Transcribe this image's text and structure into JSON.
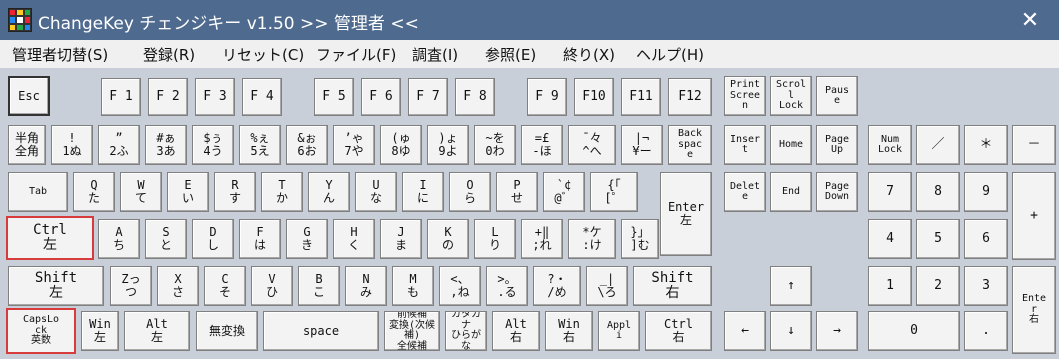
{
  "window": {
    "title": "ChangeKey チェンジキー v1.50   >> 管理者 <<",
    "close_glyph": "✕"
  },
  "menu": [
    "管理者切替(S)",
    "登録(R)",
    "リセット(C)",
    "ファイル(F)",
    "調査(I)",
    "参照(E)",
    "終り(X)",
    "ヘルプ(H)"
  ],
  "colors": {
    "titlebar": "#4f6a8f",
    "highlight": "#d83b3b",
    "background": "#c9cfd9"
  },
  "keys": {
    "esc": "Esc",
    "f1": "F 1",
    "f2": "F 2",
    "f3": "F 3",
    "f4": "F 4",
    "f5": "F 5",
    "f6": "F 6",
    "f7": "F 7",
    "f8": "F 8",
    "f9": "F 9",
    "f10": "F10",
    "f11": "F11",
    "f12": "F12",
    "printscreen": "Print\nScree\nn",
    "scrolllock": "Scrol\nl\nLock",
    "pause": "Paus\ne",
    "hankaku": "半角\n全角",
    "d1": "!   \n1ぬ",
    "d2": "”   \n2ふ",
    "d3": "#ぁ\n3あ",
    "d4": "$ぅ\n4う",
    "d5": "%ぇ\n5え",
    "d6": "&ぉ\n6お",
    "d7": "’ゃ\n7や",
    "d8": "(ゅ\n8ゆ",
    "d9": ")ょ\n9よ",
    "d0": "~を\n0わ",
    "minus": "=£\n-ほ",
    "caret": "¯々\n^へ",
    "yen": "|¬\n¥ー",
    "backspace": "Back\nspac\ne",
    "insert": "Inser\nt",
    "home": "Home",
    "pageup": "Page\nUp",
    "numlock": "Num\nLock",
    "numdiv": "／",
    "nummul": "＊",
    "numsub": "－",
    "tab": "Tab",
    "q": "Q   \n た",
    "w": "W   \n て",
    "e": "E   \n い",
    "r": "R   \n す",
    "t": "T   \n か",
    "y": "Y   \n ん",
    "u": "U   \n な",
    "i": "I   \n に",
    "o": "O   \n ら",
    "p": "P   \n せ",
    "at": "`¢\n@゛",
    "bracket": "{「\n[゜",
    "enter": "Enter\n左",
    "delete": "Delet\ne",
    "end": "End",
    "pagedown": "Page\nDown",
    "n7": "7",
    "n8": "8",
    "n9": "9",
    "numadd": "+",
    "ctrl_left": "Ctrl\n左",
    "a": "A   \n ち",
    "s": "S   \n と",
    "d": "D   \n し",
    "f": "F   \n は",
    "g": "G   \n き",
    "h": "H   \n く",
    "j": "J   \n ま",
    "k": "K   \n の",
    "l": "L   \n り",
    "semicolon": "+‖\n;れ",
    "colon": "*ケ\n:け",
    "rbracket": "}」\n]む",
    "n4": "4",
    "n5": "5",
    "n6": "6",
    "shift_left": "Shift\n左",
    "z": "Zっ\n つ",
    "x": "X   \n さ",
    "c": "C   \n そ",
    "v": "V   \n ひ",
    "b": "B   \n こ",
    "n": "N   \n み",
    "m": "M   \n も",
    "comma": "<、\n,ね",
    "period": ">。\n.る",
    "slash": "?・\n/め",
    "backslash": "_|\n\\ろ",
    "shift_right": "Shift\n右",
    "up": "↑",
    "n1": "1",
    "n2": "2",
    "n3": "3",
    "numenter": "Ente\nr\n右",
    "capslock": "CapsLo\nck\n英数",
    "win_left": "Win\n左",
    "alt_left": "Alt\n左",
    "muhenkan": "無変換",
    "space": "space",
    "henkan": "前候補\n変換(次候補)\n全候補",
    "kana": "カタカ\nナ\nひらが\nな",
    "alt_right": "Alt\n右",
    "win_right": "Win\n右",
    "apps": "Appl\ni",
    "ctrl_right": "Ctrl\n右",
    "left": "←",
    "down": "↓",
    "right": "→",
    "n0": "0",
    "numdot": "."
  }
}
